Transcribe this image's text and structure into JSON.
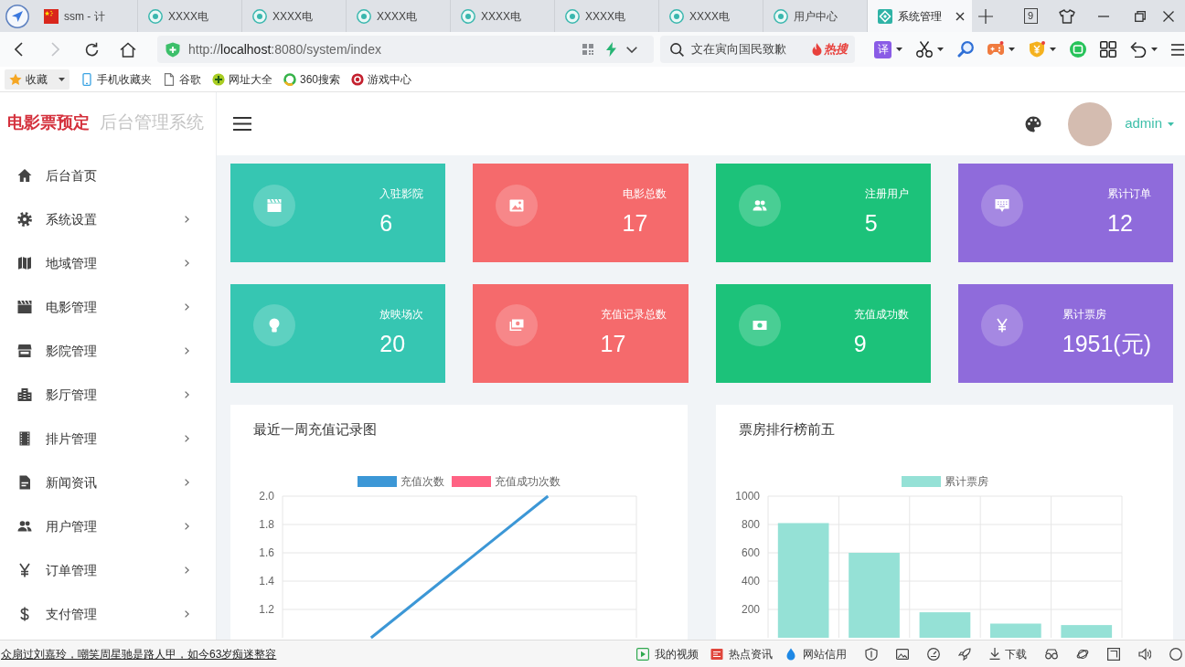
{
  "browser": {
    "tabs": [
      {
        "title": "ssm - 计",
        "kind": "project",
        "selected": false
      },
      {
        "title": "XXXX电",
        "kind": "site",
        "selected": false
      },
      {
        "title": "XXXX电",
        "kind": "site",
        "selected": false
      },
      {
        "title": "XXXX电",
        "kind": "site",
        "selected": false
      },
      {
        "title": "XXXX电",
        "kind": "site",
        "selected": false
      },
      {
        "title": "XXXX电",
        "kind": "site",
        "selected": false
      },
      {
        "title": "XXXX电",
        "kind": "site",
        "selected": false
      },
      {
        "title": "用户中心",
        "kind": "site",
        "selected": false
      },
      {
        "title": "系统管理",
        "kind": "system",
        "selected": true
      }
    ],
    "tab_count": "9",
    "address_bar": {
      "scheme": "http://",
      "host": "localhost",
      "path": ":8080/system/index"
    },
    "search": {
      "placeholder": "文在寅向国民致歉",
      "hot_label": "热搜"
    },
    "toolbar": [
      {
        "label": "译",
        "dropdown": true
      },
      {
        "dropdown": true
      },
      {
        "dropdown": false
      },
      {
        "dropdown": true
      },
      {
        "dropdown": true
      },
      {
        "dropdown": false
      },
      {
        "dropdown": false
      },
      {
        "dropdown": true
      }
    ],
    "bookmarks": [
      {
        "label": "收藏",
        "dropdown": true
      },
      {
        "label": "手机收藏夹",
        "dropdown": false
      },
      {
        "label": "谷歌",
        "dropdown": false
      },
      {
        "label": "网址大全",
        "dropdown": false
      },
      {
        "label": "360搜索",
        "dropdown": false
      },
      {
        "label": "游戏中心",
        "dropdown": false
      }
    ]
  },
  "app": {
    "brand": {
      "name": "电影票预定",
      "subtitle": "后台管理系统"
    },
    "menu": [
      {
        "label": "后台首页",
        "submenu": false
      },
      {
        "label": "系统设置",
        "submenu": true
      },
      {
        "label": "地域管理",
        "submenu": true
      },
      {
        "label": "电影管理",
        "submenu": true
      },
      {
        "label": "影院管理",
        "submenu": true
      },
      {
        "label": "影厅管理",
        "submenu": true
      },
      {
        "label": "排片管理",
        "submenu": true
      },
      {
        "label": "新闻资讯",
        "submenu": true
      },
      {
        "label": "用户管理",
        "submenu": true
      },
      {
        "label": "订单管理",
        "submenu": true
      },
      {
        "label": "支付管理",
        "submenu": true
      }
    ],
    "user": {
      "name": "admin"
    },
    "stats": [
      {
        "label": "入驻影院",
        "value": "6",
        "color": "#36c6b2"
      },
      {
        "label": "电影总数",
        "value": "17",
        "color": "#f56a6c"
      },
      {
        "label": "注册用户",
        "value": "5",
        "color": "#1cc27a"
      },
      {
        "label": "累计订单",
        "value": "12",
        "color": "#8f6bdb"
      },
      {
        "label": "放映场次",
        "value": "20",
        "color": "#36c6b2"
      },
      {
        "label": "充值记录总数",
        "value": "17",
        "color": "#f56a6c"
      },
      {
        "label": "充值成功数",
        "value": "9",
        "color": "#1cc27a"
      },
      {
        "label": "累计票房",
        "value": "1951(元)",
        "color": "#8f6bdb"
      }
    ],
    "charts": [
      {
        "chart_data": {
          "type": "line",
          "title": "最近一周充值记录图",
          "categories": [
            null,
            null
          ],
          "series": [
            {
              "name": "充值次数",
              "color": "#3c97d6",
              "values": [
                1,
                2
              ]
            },
            {
              "name": "充值成功次数",
              "color": "#ff6384",
              "values": [
                null,
                null
              ]
            }
          ],
          "ylim": [
            1,
            2
          ],
          "yticks": [
            {
              "value": 1.2,
              "label": "1.2"
            },
            {
              "value": 1.4,
              "label": "1.4"
            },
            {
              "value": 1.6,
              "label": "1.6"
            },
            {
              "value": 1.8,
              "label": "1.8"
            },
            {
              "value": 2,
              "label": "2.0"
            }
          ],
          "grid": true
        }
      },
      {
        "chart_data": {
          "type": "bar",
          "title": "票房排行榜前五",
          "series": [
            {
              "name": "累计票房",
              "color": "#95e1d6",
              "values": [
                810,
                600,
                180,
                100,
                90
              ]
            }
          ],
          "ylim": [
            0,
            1000
          ],
          "yticks": [
            200,
            400,
            600,
            800,
            1000
          ],
          "grid": true
        }
      }
    ]
  },
  "status_bar": {
    "news": "众扇过刘嘉玲，嘲笑周星驰是路人甲，如今63岁痴迷整容",
    "links": [
      {
        "label": "我的视频"
      },
      {
        "label": "热点资讯"
      },
      {
        "label": "网站信用"
      }
    ],
    "download": "下载"
  }
}
